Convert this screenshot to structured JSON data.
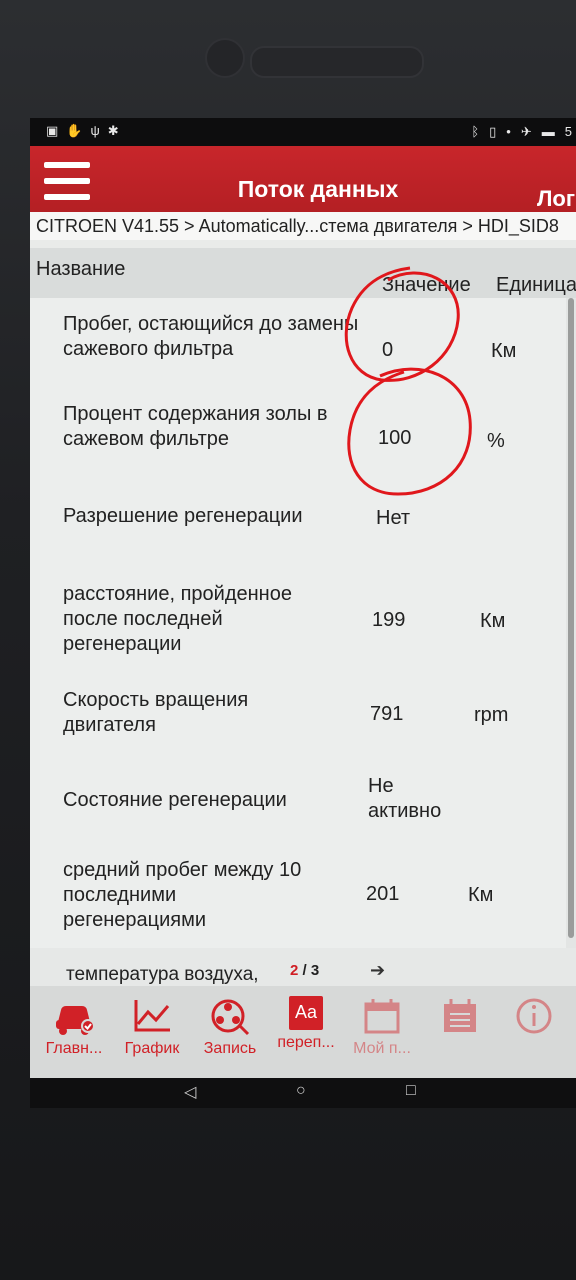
{
  "app": {
    "title": "Поток данных",
    "right_action": "Лог"
  },
  "status_bar": {
    "battery_text": "5"
  },
  "breadcrumb": "CITROEN V41.55 > Automatically...стема двигателя > HDI_SID8",
  "columns": {
    "name": "Название",
    "value": "Значение",
    "unit": "Единица"
  },
  "rows": [
    {
      "name": "Пробег, остающийся до замены сажевого фильтра",
      "value": "0",
      "unit": "Км"
    },
    {
      "name": "Процент содержания золы в сажевом фильтре",
      "value": "100",
      "unit": "%"
    },
    {
      "name": "Разрешение регенерации",
      "value": "Нет",
      "unit": ""
    },
    {
      "name": "расстояние, пройденное после последней регенерации",
      "value": "199",
      "unit": "Км"
    },
    {
      "name": "Скорость вращения двигателя",
      "value": "791",
      "unit": "rpm"
    },
    {
      "name": "Состояние регенерации",
      "value": "Не активно",
      "unit": ""
    },
    {
      "name": "средний пробег между 10 последними регенерациями",
      "value": "201",
      "unit": "Км"
    }
  ],
  "next_row": {
    "name": "температура воздуха,",
    "page_current": "2",
    "page_total": "/ 3"
  },
  "toolbar": [
    {
      "label": "Главн...",
      "icon": "car-check-icon"
    },
    {
      "label": "График",
      "icon": "chart-icon"
    },
    {
      "label": "Запись",
      "icon": "record-reel-icon"
    },
    {
      "label": "переп...",
      "icon": "font-size-icon",
      "icon_text": "Aa"
    },
    {
      "label": "Мой п...",
      "icon": "calendar-icon"
    },
    {
      "label": "",
      "icon": "calendar-list-icon"
    },
    {
      "label": "",
      "icon": "info-icon"
    }
  ],
  "colors": {
    "accent": "#c8262b",
    "toolbar_icon": "#d12127",
    "annotation": "#e0171c"
  }
}
